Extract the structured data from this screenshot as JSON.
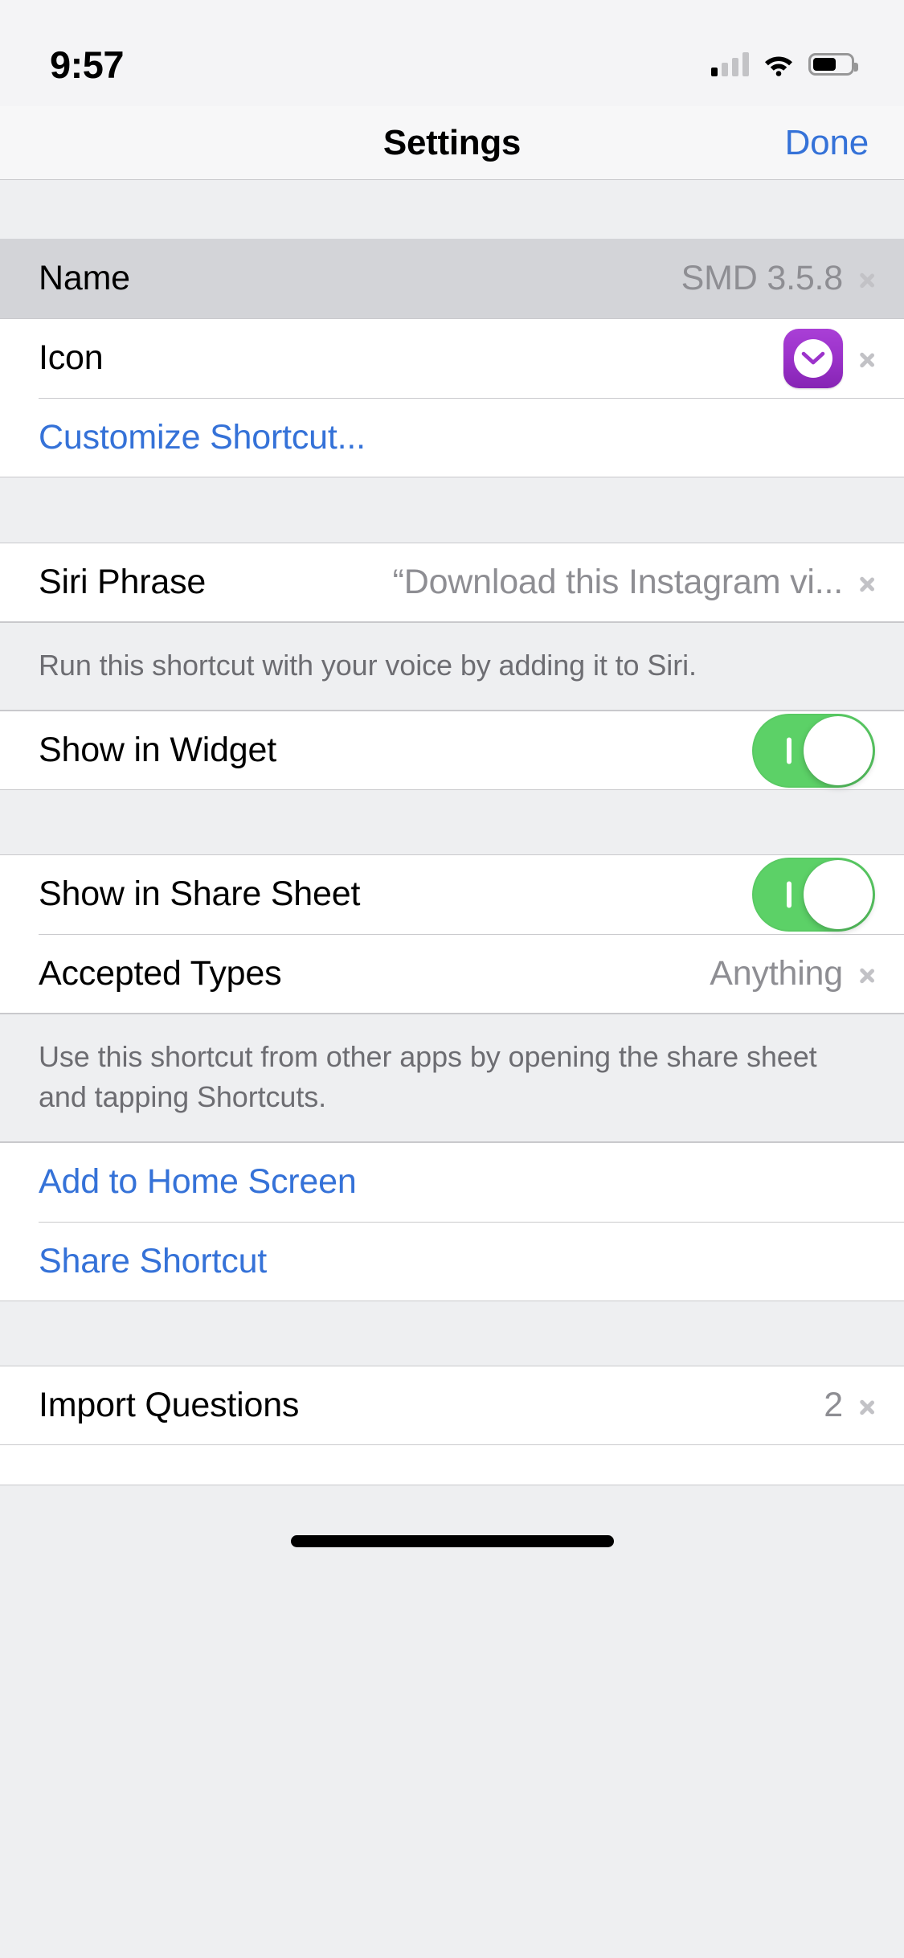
{
  "status_bar": {
    "time": "9:57",
    "signal_icon": "cellular-signal-icon",
    "signal_bars_filled": 1,
    "signal_bars_total": 4,
    "wifi_icon": "wifi-icon",
    "battery_icon": "battery-icon",
    "battery_level_percent": 62
  },
  "nav": {
    "title": "Settings",
    "done_label": "Done"
  },
  "colors": {
    "accent_blue": "#3572d8",
    "toggle_on_green": "#5cd167",
    "icon_purple": "#9c33cb",
    "value_gray": "#8e8e93",
    "group_background": "#eeeff1",
    "row_selected": "#d3d4d8"
  },
  "groups": {
    "details": {
      "name_row": {
        "label": "Name",
        "value": "SMD 3.5.8",
        "selected": true
      },
      "icon_row": {
        "label": "Icon",
        "icon_name": "download-chevron-icon"
      },
      "customize_row": {
        "label": "Customize Shortcut..."
      }
    },
    "siri": {
      "phrase_row": {
        "label": "Siri Phrase",
        "value": "“Download this Instagram vi..."
      },
      "footer": "Run this shortcut with your voice by adding it to Siri."
    },
    "widget": {
      "show_in_widget_row": {
        "label": "Show in Widget",
        "toggle_on": true
      }
    },
    "share_sheet": {
      "show_in_share_sheet_row": {
        "label": "Show in Share Sheet",
        "toggle_on": true
      },
      "accepted_types_row": {
        "label": "Accepted Types",
        "value": "Anything"
      },
      "footer": "Use this shortcut from other apps by opening the share sheet and tapping Shortcuts."
    },
    "actions": {
      "add_to_home_screen_row": {
        "label": "Add to Home Screen"
      },
      "share_shortcut_row": {
        "label": "Share Shortcut"
      }
    },
    "import": {
      "import_questions_row": {
        "label": "Import Questions",
        "value": "2"
      }
    }
  }
}
